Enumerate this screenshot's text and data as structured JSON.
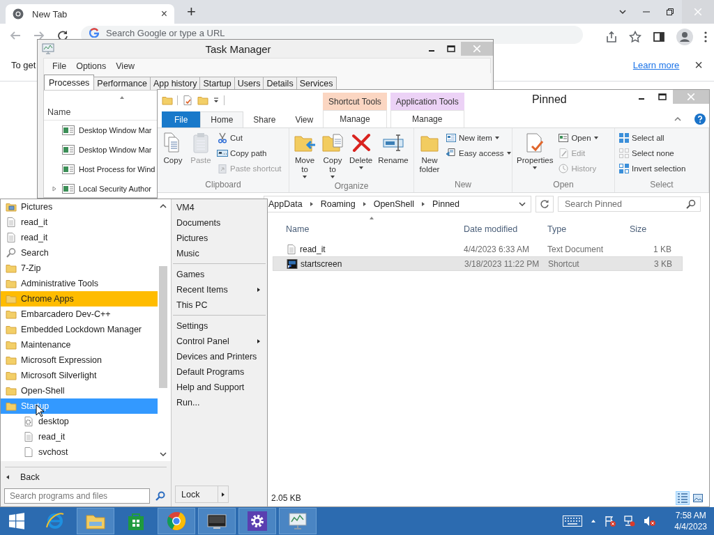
{
  "browser": {
    "tab": {
      "title": "New Tab",
      "close": "×"
    },
    "new_tab": "+",
    "address": {
      "placeholder": "Search Google or type a URL"
    },
    "infobar": {
      "text": "To get",
      "link": "Learn more",
      "close": "×"
    }
  },
  "task_manager": {
    "title": "Task Manager",
    "menu": [
      "File",
      "Options",
      "View"
    ],
    "tabs": [
      {
        "label": "Processes",
        "selected": true
      },
      {
        "label": "Performance",
        "selected": false
      },
      {
        "label": "App history",
        "selected": false
      },
      {
        "label": "Startup",
        "selected": false
      },
      {
        "label": "Users",
        "selected": false
      },
      {
        "label": "Details",
        "selected": false
      },
      {
        "label": "Services",
        "selected": false
      }
    ],
    "columns": [
      "Name"
    ],
    "processes": [
      {
        "name": "Desktop Window Mar",
        "expandable": false
      },
      {
        "name": "Desktop Window Mar",
        "expandable": false
      },
      {
        "name": "Host Process for Wind",
        "expandable": false
      },
      {
        "name": "Local Security Author",
        "expandable": true
      }
    ]
  },
  "explorer": {
    "title": "Pinned",
    "ribbon_tabs": [
      {
        "label": "File",
        "kind": "file",
        "selected": false
      },
      {
        "label": "Home",
        "kind": "tab",
        "selected": true
      },
      {
        "label": "Share",
        "kind": "tab",
        "selected": false
      },
      {
        "label": "View",
        "kind": "tab",
        "selected": false
      }
    ],
    "context_tabs": [
      {
        "label": "Shortcut Tools",
        "color": "#fbd6c2",
        "tab": {
          "label": "Manage",
          "selected": false
        }
      },
      {
        "label": "Application Tools",
        "color": "#ecd2f6",
        "tab": {
          "label": "Manage",
          "selected": false
        }
      }
    ],
    "groups": [
      {
        "label": "Clipboard",
        "items": [
          {
            "kind": "large",
            "label": "Copy",
            "disabled": false,
            "dropdown": false
          },
          {
            "kind": "large",
            "label": "Paste",
            "disabled": true,
            "dropdown": false
          },
          {
            "kind": "column",
            "items": [
              {
                "label": "Cut",
                "disabled": false,
                "dropdown": false
              },
              {
                "label": "Copy path",
                "disabled": false,
                "dropdown": false
              },
              {
                "label": "Paste shortcut",
                "disabled": true,
                "dropdown": false
              }
            ]
          }
        ]
      },
      {
        "label": "Organize",
        "items": [
          {
            "kind": "large",
            "label": "Move to",
            "disabled": false,
            "dropdown": true
          },
          {
            "kind": "large",
            "label": "Copy to",
            "disabled": false,
            "dropdown": true
          },
          {
            "kind": "large",
            "label": "Delete",
            "disabled": false,
            "dropdown": true
          },
          {
            "kind": "large",
            "label": "Rename",
            "disabled": false,
            "dropdown": false
          }
        ]
      },
      {
        "label": "New",
        "items": [
          {
            "kind": "large",
            "label": "New folder",
            "disabled": false,
            "dropdown": false
          },
          {
            "kind": "column",
            "items": [
              {
                "label": "New item",
                "disabled": false,
                "dropdown": true
              },
              {
                "label": "Easy access",
                "disabled": false,
                "dropdown": true
              }
            ]
          }
        ]
      },
      {
        "label": "Open",
        "items": [
          {
            "kind": "large",
            "label": "Properties",
            "disabled": false,
            "dropdown": true
          },
          {
            "kind": "column",
            "items": [
              {
                "label": "Open",
                "disabled": false,
                "dropdown": true
              },
              {
                "label": "Edit",
                "disabled": true,
                "dropdown": false
              },
              {
                "label": "History",
                "disabled": true,
                "dropdown": false
              }
            ]
          }
        ]
      },
      {
        "label": "Select",
        "items": [
          {
            "kind": "column",
            "items": [
              {
                "label": "Select all",
                "disabled": false,
                "dropdown": false
              },
              {
                "label": "Select none",
                "disabled": false,
                "dropdown": false
              },
              {
                "label": "Invert selection",
                "disabled": false,
                "dropdown": false
              }
            ]
          }
        ]
      }
    ],
    "path": [
      "AppData",
      "Roaming",
      "OpenShell",
      "Pinned"
    ],
    "search": {
      "placeholder": "Search Pinned"
    },
    "columns": [
      "Name",
      "Date modified",
      "Type",
      "Size"
    ],
    "files": [
      {
        "name": "read_it",
        "date": "4/4/2023 6:33 AM",
        "type": "Text Document",
        "size": "1 KB",
        "kind": "text",
        "selected": false
      },
      {
        "name": "startscreen",
        "date": "3/18/2023 11:22 PM",
        "type": "Shortcut",
        "size": "3 KB",
        "kind": "shortcut",
        "selected": true
      }
    ],
    "status": "2.05 KB",
    "views": [
      {
        "kind": "details",
        "selected": true
      },
      {
        "kind": "large-icons",
        "selected": false
      }
    ]
  },
  "start_menu": {
    "programs": [
      {
        "label": "Pictures",
        "kind": "pictures",
        "selected": false,
        "new": false
      },
      {
        "label": "read_it",
        "kind": "text",
        "selected": false,
        "new": false
      },
      {
        "label": "read_it",
        "kind": "text",
        "selected": false,
        "new": false
      },
      {
        "label": "Search",
        "kind": "search",
        "selected": false,
        "new": false
      },
      {
        "label": "7-Zip",
        "kind": "folder",
        "selected": false,
        "new": false
      },
      {
        "label": "Administrative Tools",
        "kind": "folder",
        "selected": false,
        "new": false
      },
      {
        "label": "Chrome Apps",
        "kind": "folder",
        "selected": false,
        "new": true
      },
      {
        "label": "Embarcadero Dev-C++",
        "kind": "folder",
        "selected": false,
        "new": false
      },
      {
        "label": "Embedded Lockdown Manager",
        "kind": "folder",
        "selected": false,
        "new": false
      },
      {
        "label": "Maintenance",
        "kind": "folder",
        "selected": false,
        "new": false
      },
      {
        "label": "Microsoft Expression",
        "kind": "folder",
        "selected": false,
        "new": false
      },
      {
        "label": "Microsoft Silverlight",
        "kind": "folder",
        "selected": false,
        "new": false
      },
      {
        "label": "Open-Shell",
        "kind": "folder",
        "selected": false,
        "new": false
      },
      {
        "label": "Startup",
        "kind": "folder",
        "selected": true,
        "new": false,
        "children": [
          {
            "label": "desktop",
            "kind": "config",
            "selected": false,
            "new": false
          },
          {
            "label": "read_it",
            "kind": "text",
            "selected": false,
            "new": false
          },
          {
            "label": "svchost",
            "kind": "blank",
            "selected": false,
            "new": false
          }
        ]
      }
    ],
    "places": [
      [
        {
          "label": "VM4",
          "submenu": false
        },
        {
          "label": "Documents",
          "submenu": false
        },
        {
          "label": "Pictures",
          "submenu": false
        },
        {
          "label": "Music",
          "submenu": false
        }
      ],
      [
        {
          "label": "Games",
          "submenu": false
        },
        {
          "label": "Recent Items",
          "submenu": true
        },
        {
          "label": "This PC",
          "submenu": false
        }
      ],
      [
        {
          "label": "Settings",
          "submenu": false
        },
        {
          "label": "Control Panel",
          "submenu": true
        },
        {
          "label": "Devices and Printers",
          "submenu": false
        },
        {
          "label": "Default Programs",
          "submenu": false
        },
        {
          "label": "Help and Support",
          "submenu": false
        },
        {
          "label": "Run...",
          "submenu": false
        }
      ]
    ],
    "back": "Back",
    "search": {
      "placeholder": "Search programs and files"
    },
    "shutdown": {
      "label": "Lock"
    }
  },
  "taskbar": {
    "apps": [
      {
        "kind": "browser-e",
        "running": false
      },
      {
        "kind": "explorer",
        "running": true
      },
      {
        "kind": "store",
        "running": false
      },
      {
        "kind": "chrome",
        "running": true
      },
      {
        "kind": "terminal",
        "running": true
      },
      {
        "kind": "settings",
        "running": true
      },
      {
        "kind": "taskmgr",
        "running": true
      }
    ],
    "clock": {
      "time": "7:58 AM",
      "date": "4/4/2023"
    }
  }
}
